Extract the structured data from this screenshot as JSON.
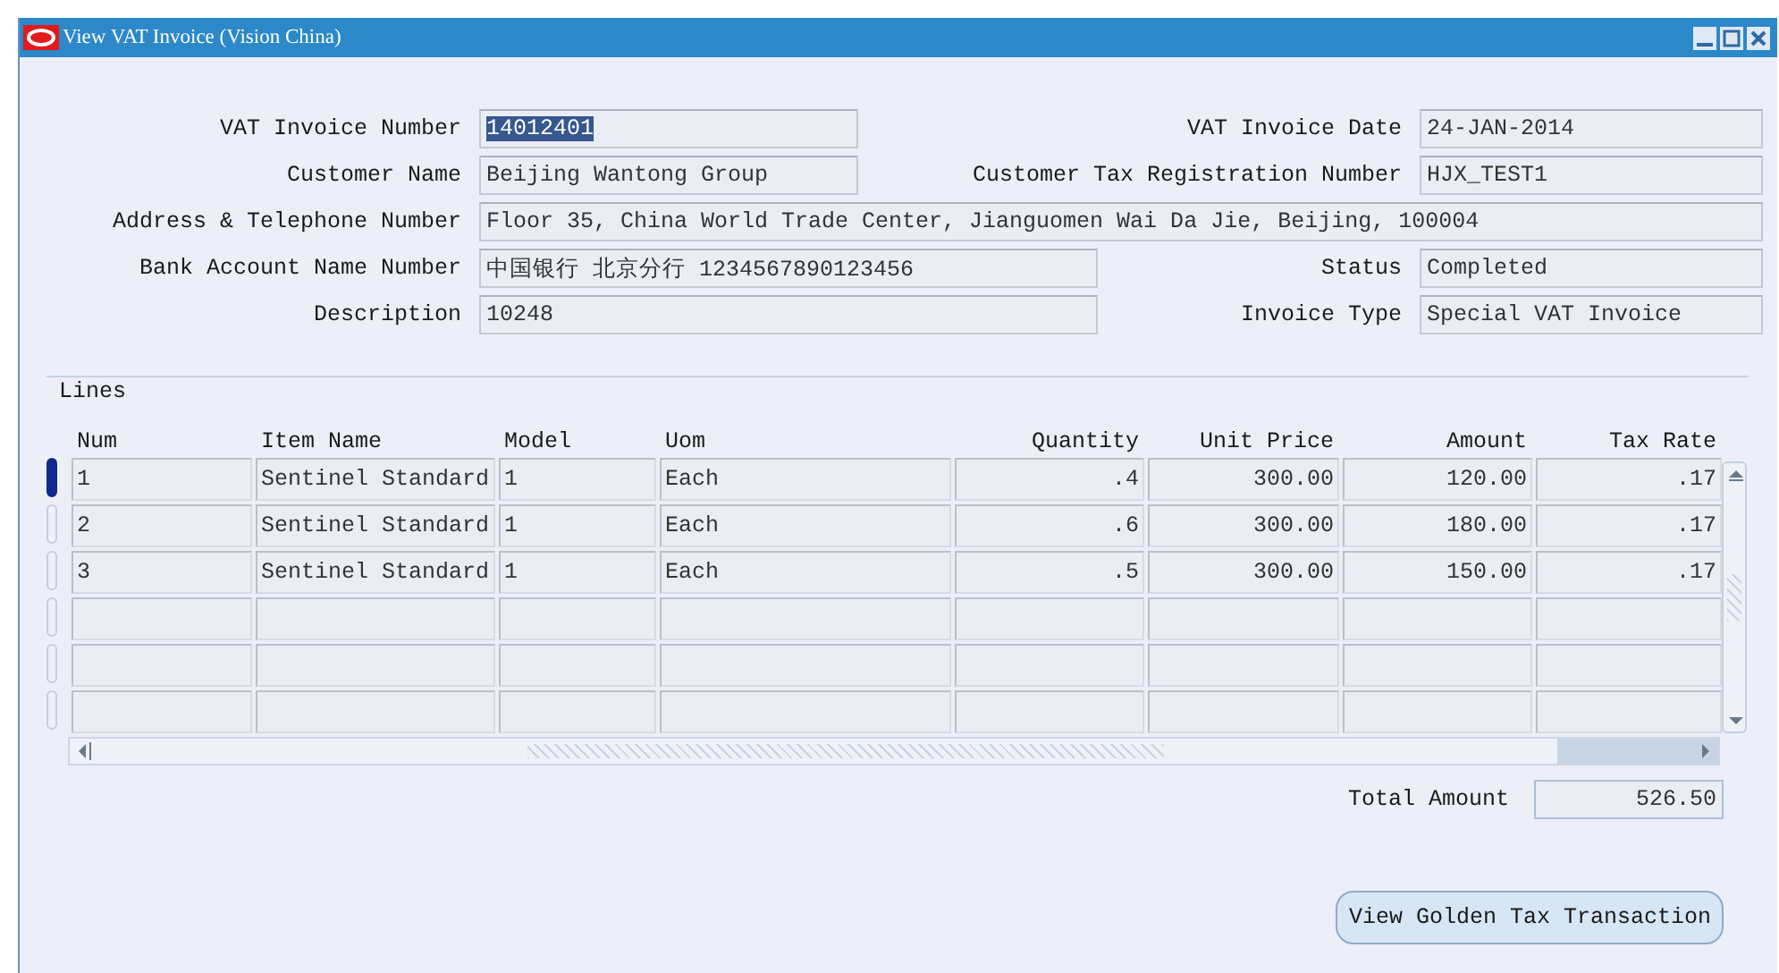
{
  "window": {
    "title": "View VAT Invoice (Vision China)"
  },
  "header_rows": [
    {
      "fields": [
        {
          "label": "VAT Invoice Number",
          "value": "14012401",
          "kind": "short",
          "selected": true
        },
        {
          "label": "VAT Invoice Date",
          "value": "24-JAN-2014",
          "kind": "short",
          "selected": false
        }
      ]
    },
    {
      "fields": [
        {
          "label": "Customer Name",
          "value": "Beijing Wantong Group",
          "kind": "short",
          "selected": false
        },
        {
          "label": "Customer Tax Registration Number",
          "value": "HJX_TEST1",
          "kind": "short",
          "selected": false
        }
      ]
    },
    {
      "fields": [
        {
          "label": "Address & Telephone Number",
          "value": "Floor 35, China World Trade Center, Jianguomen Wai Da Jie, Beijing, 100004",
          "kind": "full",
          "selected": false
        }
      ]
    },
    {
      "fields": [
        {
          "label": "Bank Account Name Number",
          "value": "中国银行 北京分行 1234567890123456",
          "kind": "medium",
          "selected": false
        },
        {
          "label": "Status",
          "value": "Completed",
          "kind": "short",
          "selected": false
        }
      ]
    },
    {
      "fields": [
        {
          "label": "Description",
          "value": "10248",
          "kind": "medium",
          "selected": false
        },
        {
          "label": "Invoice Type",
          "value": "Special VAT Invoice",
          "kind": "short",
          "selected": false
        }
      ]
    }
  ],
  "lines": {
    "title": "Lines",
    "columns": [
      {
        "name": "Num",
        "kind": "text"
      },
      {
        "name": "Item Name",
        "kind": "text"
      },
      {
        "name": "Model",
        "kind": "text"
      },
      {
        "name": "Uom",
        "kind": "text"
      },
      {
        "name": "Quantity",
        "kind": "number"
      },
      {
        "name": "Unit Price",
        "kind": "number"
      },
      {
        "name": "Amount",
        "kind": "number"
      },
      {
        "name": "Tax Rate",
        "kind": "number"
      }
    ],
    "rows": [
      {
        "selected": true,
        "cells": [
          "1",
          "Sentinel Standard",
          "1",
          "Each",
          ".4",
          "300.00",
          "120.00",
          ".17"
        ]
      },
      {
        "selected": false,
        "cells": [
          "2",
          "Sentinel Standard",
          "1",
          "Each",
          ".6",
          "300.00",
          "180.00",
          ".17"
        ]
      },
      {
        "selected": false,
        "cells": [
          "3",
          "Sentinel Standard",
          "1",
          "Each",
          ".5",
          "300.00",
          "150.00",
          ".17"
        ]
      }
    ]
  },
  "total": {
    "label": "Total Amount",
    "value": "526.50"
  },
  "buttons": [
    "View Golden Tax Transaction"
  ]
}
